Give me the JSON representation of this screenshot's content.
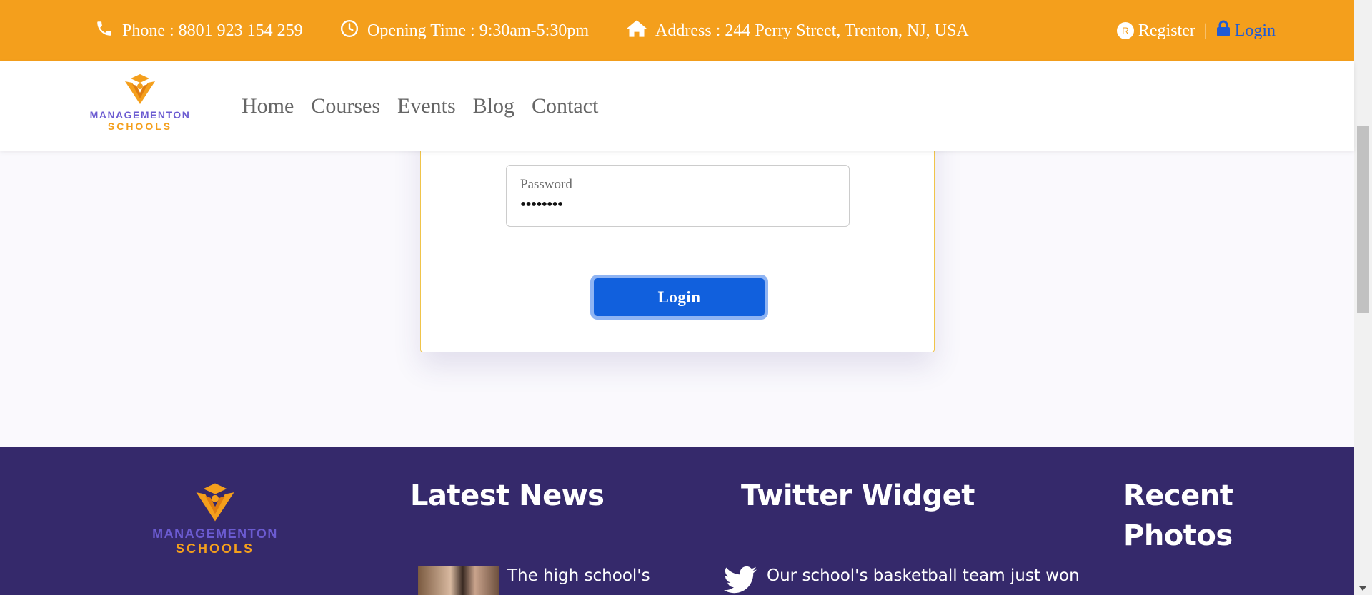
{
  "topbar": {
    "phone_label": "Phone :  8801 923 154 259",
    "hours_label": "Opening Time :  9:30am-5:30pm",
    "address_label": "Address :  244 Perry Street, Trenton, NJ, USA",
    "register_label": "Register",
    "separator": "|",
    "login_label": "Login"
  },
  "logo": {
    "line1": "MANAGEMENTON",
    "line2": "SCHOOLS"
  },
  "nav": {
    "items": [
      "Home",
      "Courses",
      "Events",
      "Blog",
      "Contact"
    ]
  },
  "login_form": {
    "password_label": "Password",
    "password_value": "••••••••",
    "submit_label": "Login"
  },
  "footer": {
    "logo_line1": "MANAGEMENTON",
    "logo_line2": "SCHOOLS",
    "news_heading": "Latest News",
    "news_item_text": "The high school's",
    "twitter_heading": "Twitter Widget",
    "tweet_text": "Our school's basketball team just won",
    "photos_heading_line1": "Recent",
    "photos_heading_line2": "Photos"
  },
  "colors": {
    "topbar_bg": "#f49f1c",
    "footer_bg": "#35296b",
    "button_bg": "#1160dd",
    "logo_purple": "#6b5bd1",
    "logo_orange": "#f49f1c"
  },
  "icons": [
    "phone-icon",
    "clock-icon",
    "home-icon",
    "register-icon",
    "lock-icon",
    "twitter-icon"
  ]
}
